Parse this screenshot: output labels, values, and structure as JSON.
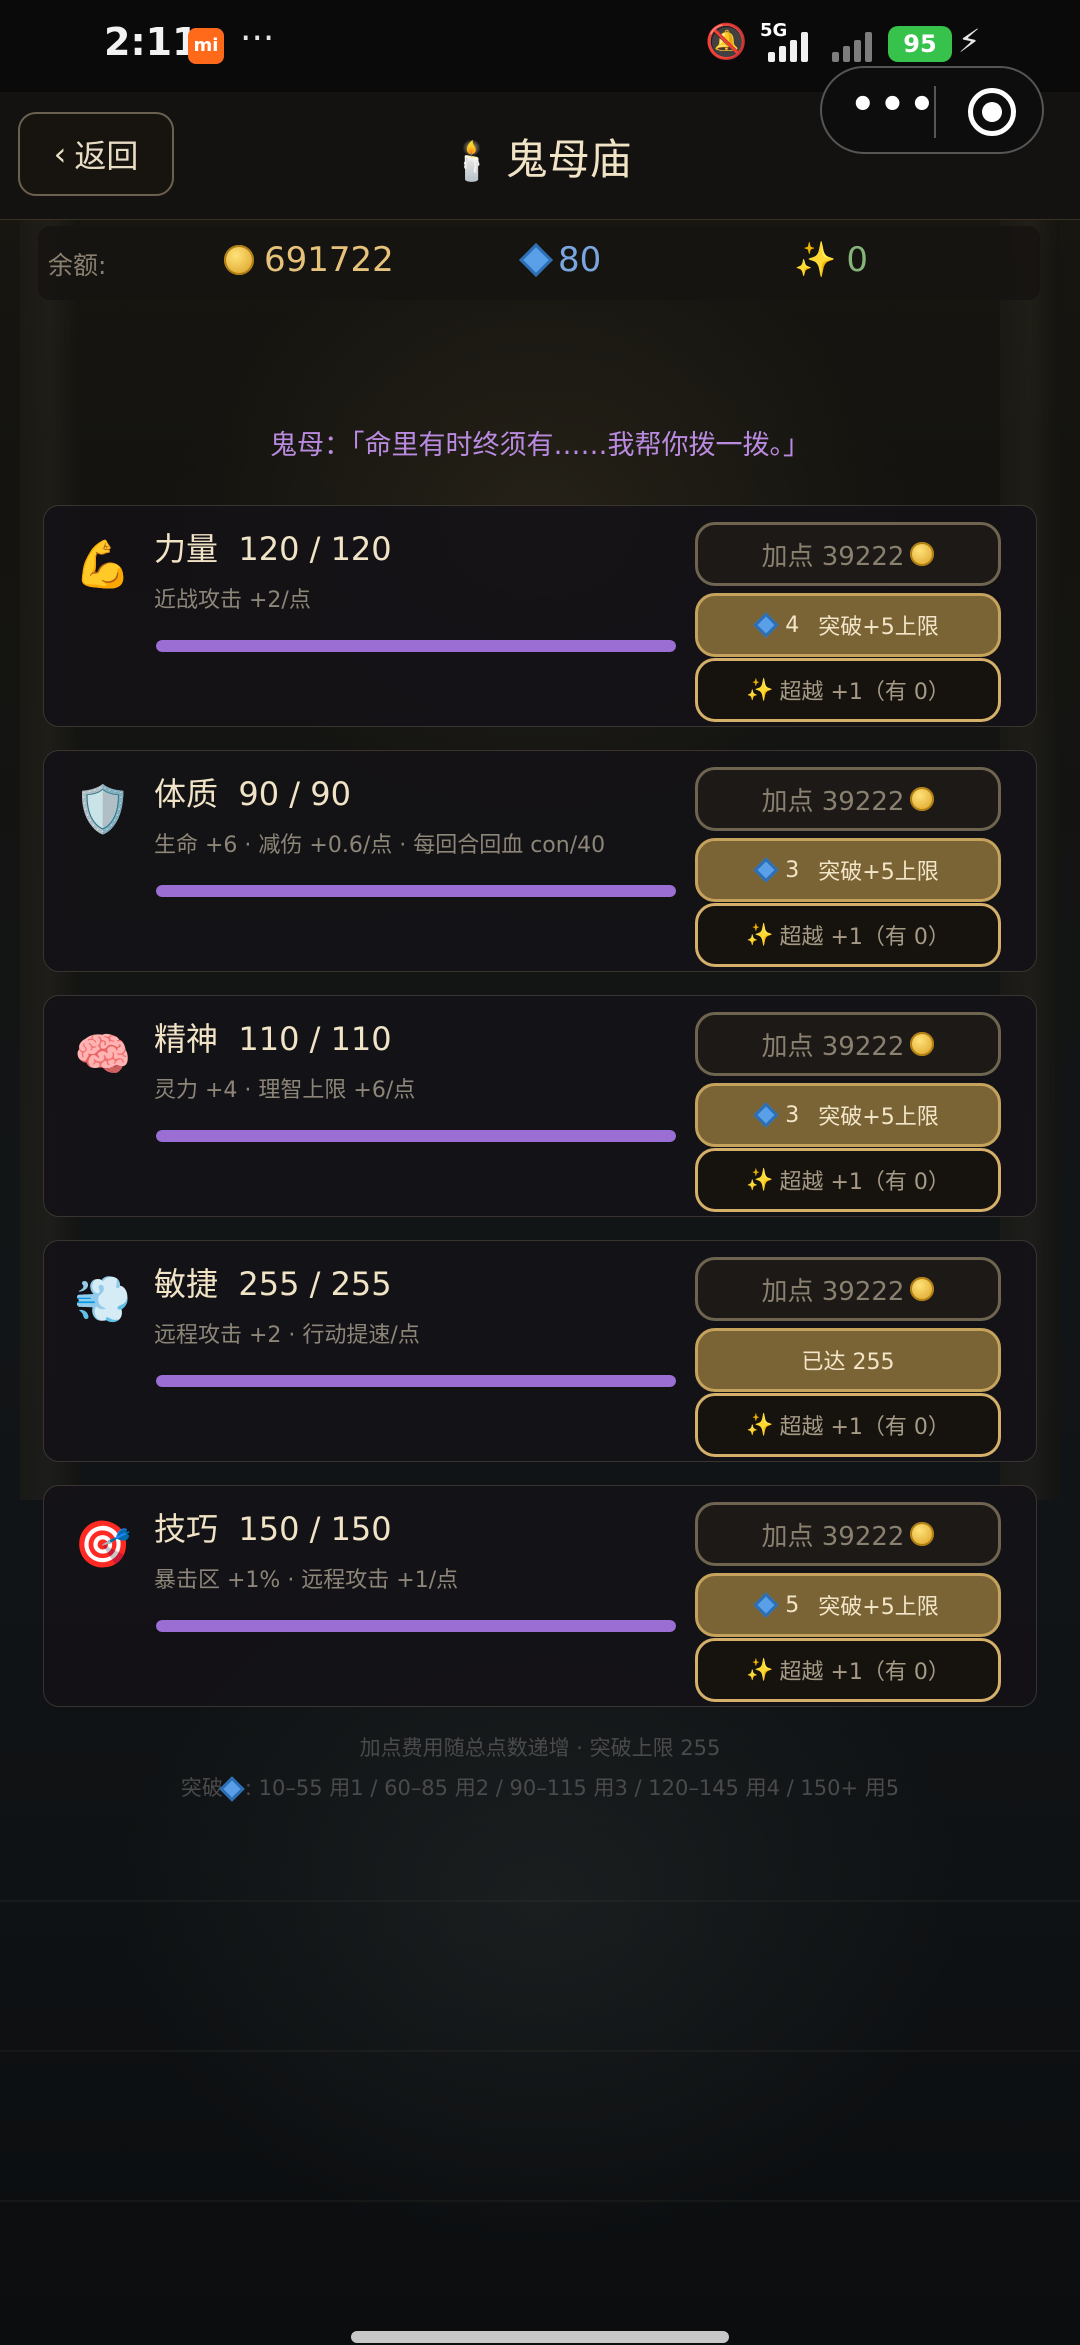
{
  "status_bar": {
    "time": "2:11",
    "mi_label": "mi",
    "more": "···",
    "network": "5G",
    "battery": "95"
  },
  "header": {
    "back_label": "返回",
    "title": "鬼母庙"
  },
  "balance": {
    "label": "余额:",
    "coins": "691722",
    "gems": "80",
    "sparkles": "0"
  },
  "dialog": "鬼母：「命里有时终须有……我帮你拨一拨。」",
  "stats": [
    {
      "icon": "muscle-icon",
      "name": "力量",
      "current": "120 / 120",
      "desc": "近战攻击 +2/点",
      "progress": 1.0,
      "add_label": "加点 39222",
      "break_cost": "4",
      "break_label": "突破+5上限",
      "transcend_label": "超越 +1（有 0）"
    },
    {
      "icon": "shield-icon",
      "name": "体质",
      "current": "90 / 90",
      "desc": "生命 +6 · 减伤 +0.6/点 · 每回合回血 con/40",
      "progress": 1.0,
      "add_label": "加点 39222",
      "break_cost": "3",
      "break_label": "突破+5上限",
      "transcend_label": "超越 +1（有 0）"
    },
    {
      "icon": "brain-icon",
      "name": "精神",
      "current": "110 / 110",
      "desc": "灵力 +4 · 理智上限 +6/点",
      "progress": 1.0,
      "add_label": "加点 39222",
      "break_cost": "3",
      "break_label": "突破+5上限",
      "transcend_label": "超越 +1（有 0）"
    },
    {
      "icon": "wind-icon",
      "name": "敏捷",
      "current": "255 / 255",
      "desc": "远程攻击 +2 · 行动提速/点",
      "progress": 1.0,
      "add_label": "加点 39222",
      "break_cost": "",
      "break_label": "已达 255",
      "transcend_label": "超越 +1（有 0）"
    },
    {
      "icon": "target-icon",
      "name": "技巧",
      "current": "150 / 150",
      "desc": "暴击区 +1% · 远程攻击 +1/点",
      "progress": 1.0,
      "add_label": "加点 39222",
      "break_cost": "5",
      "break_label": "突破+5上限",
      "transcend_label": "超越 +1（有 0）"
    }
  ],
  "footer": {
    "line1": "加点费用随总点数递增 · 突破上限 255",
    "line2": "10–55 用1 / 60–85 用2 / 90–115 用3 / 120–145 用4 / 150+ 用5",
    "line2_prefix": "突破"
  }
}
